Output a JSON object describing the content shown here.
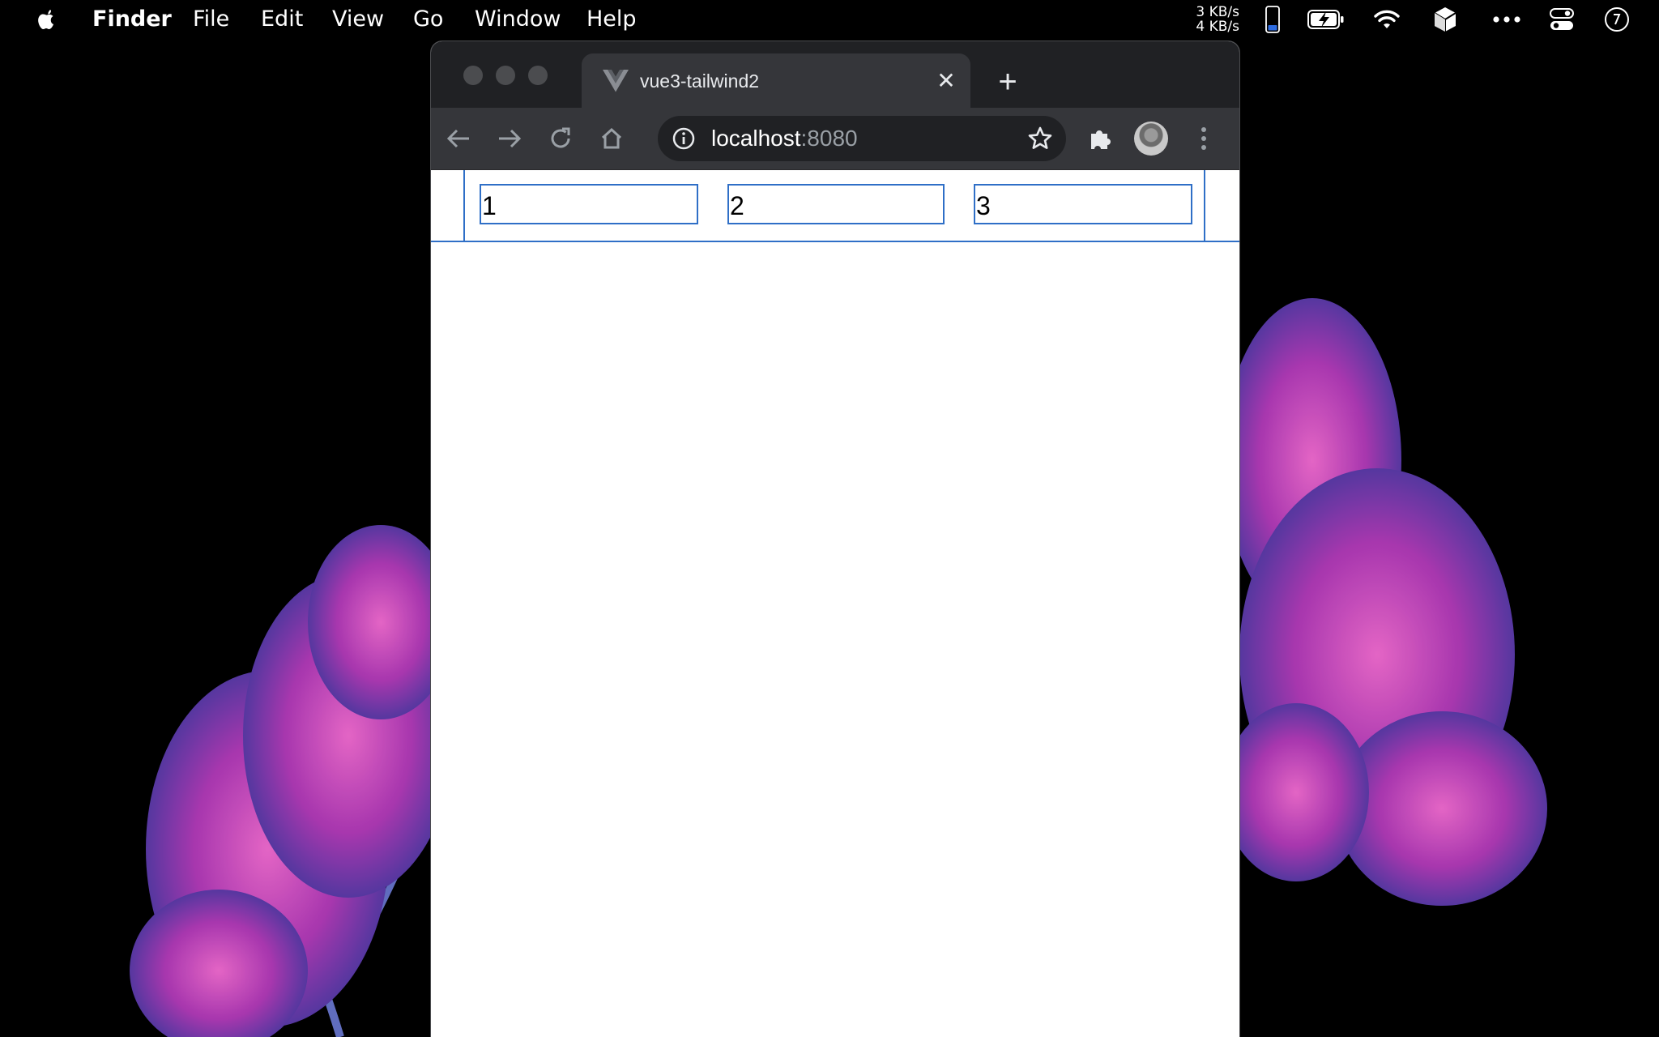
{
  "menubar": {
    "app_name": "Finder",
    "menus": [
      "File",
      "Edit",
      "View",
      "Go",
      "Window",
      "Help"
    ],
    "net_up": "3 KB/s",
    "net_down": "4 KB/s",
    "icons": [
      "apple-icon",
      "battery-phone-icon",
      "battery-charging-icon",
      "wifi-icon",
      "cube-app-icon",
      "more-dots-icon",
      "control-center-icon",
      "clock-icon"
    ]
  },
  "browser": {
    "tab": {
      "title": "vue3-tailwind2",
      "favicon": "vue-logo-icon"
    },
    "new_tab_label": "+",
    "address": {
      "host": "localhost",
      "port": ":8080"
    },
    "profile": "avatar"
  },
  "page": {
    "inputs": [
      {
        "value": "1"
      },
      {
        "value": "2"
      },
      {
        "value": "3"
      }
    ]
  },
  "colors": {
    "accent_border": "#2f6fc7",
    "tabstrip": "#202124",
    "toolbar": "#35363a"
  }
}
